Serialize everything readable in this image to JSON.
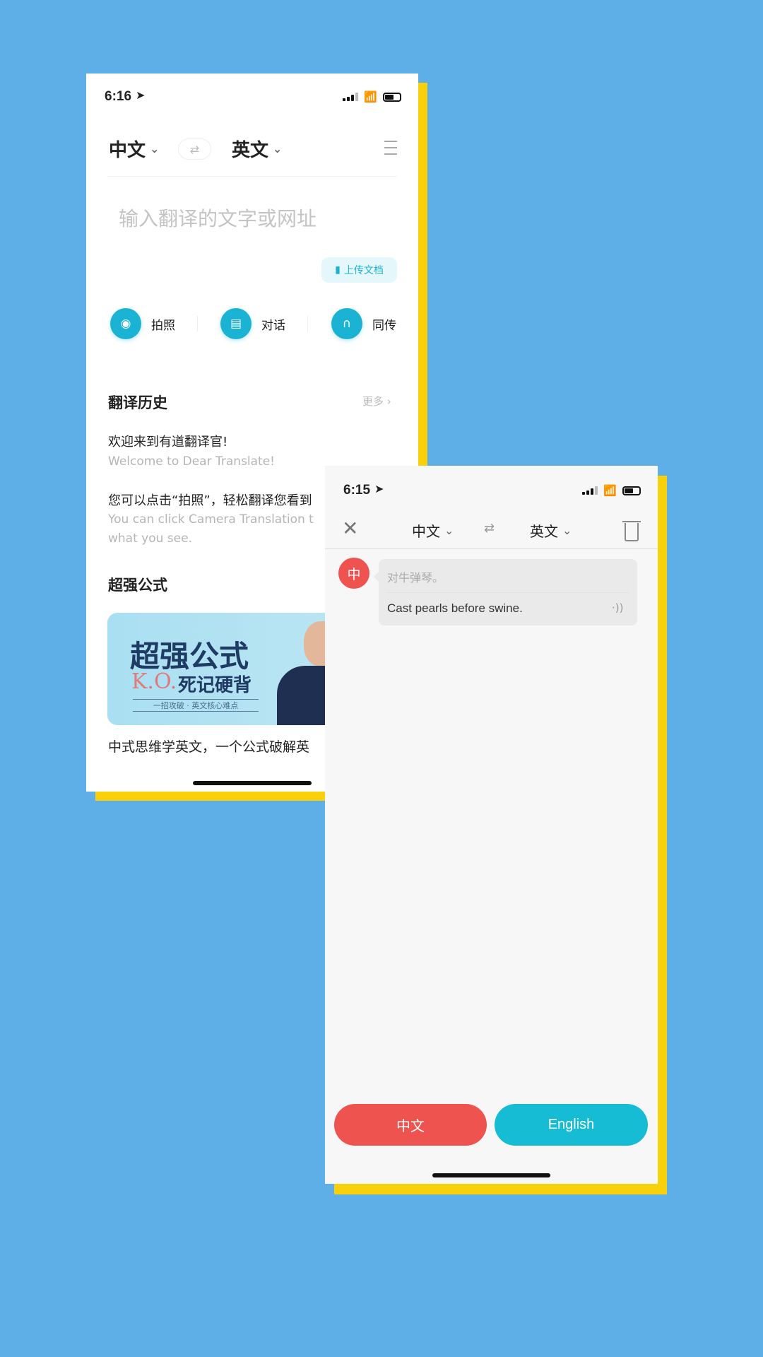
{
  "colors": {
    "background": "#5eafe8",
    "shadow": "#f9d10a",
    "accent": "#1ab3d3",
    "red": "#ef5350"
  },
  "screen1": {
    "status_time": "6:16",
    "source_lang": "中文",
    "target_lang": "英文",
    "input_placeholder": "输入翻译的文字或网址",
    "upload_label": "上传文档",
    "tools": [
      {
        "label": "拍照",
        "icon": "camera-icon"
      },
      {
        "label": "对话",
        "icon": "chat-icon"
      },
      {
        "label": "同传",
        "icon": "simultaneous-icon"
      }
    ],
    "history": {
      "title": "翻译历史",
      "more": "更多",
      "items": [
        {
          "zh": "欢迎来到有道翻译官!",
          "en": "Welcome to Dear Translate!"
        },
        {
          "zh": "您可以点击“拍照”，轻松翻译您看到",
          "en": "You can click Camera Translation t",
          "en2": "what you see."
        }
      ]
    },
    "promo": {
      "title": "超强公式",
      "banner_title": "超强公式",
      "banner_ko": "K.O.",
      "banner_sub": "死记硬背",
      "banner_tag": "一招攻破 · 英文核心难点",
      "caption": "中式思维学英文，一个公式破解英"
    }
  },
  "screen2": {
    "status_time": "6:15",
    "source_lang": "中文",
    "target_lang": "英文",
    "message": {
      "avatar": "中",
      "source": "对牛弹琴。",
      "translation": "Cast pearls before swine."
    },
    "buttons": {
      "chinese": "中文",
      "english": "English"
    }
  }
}
